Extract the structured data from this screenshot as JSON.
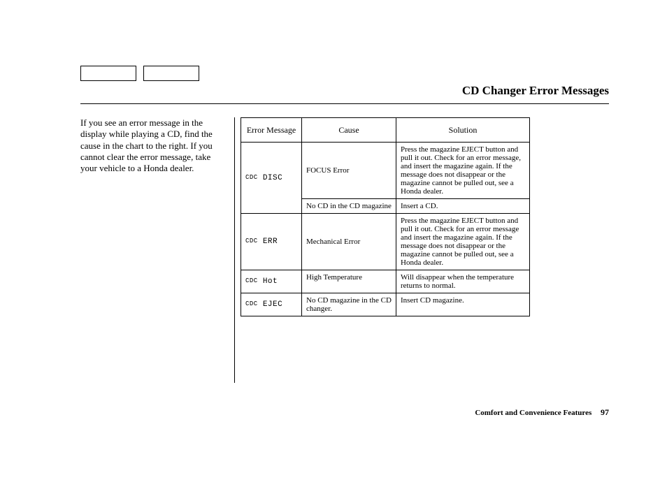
{
  "header": {
    "title": "CD Changer Error Messages"
  },
  "intro": "If you see an error message in the display while playing a CD, find the cause in the chart to the right. If you cannot clear the error message, take your vehicle to a Honda dealer.",
  "table": {
    "head": {
      "c1": "Error Message",
      "c2": "Cause",
      "c3": "Solution"
    },
    "rows": [
      {
        "display_prefix": "CDC",
        "display_main": "DISC",
        "cause": "FOCUS Error",
        "solution": "Press the magazine EJECT button and pull it out. Check for an error message, and insert the magazine again. If the message does not disappear or the magazine cannot be pulled out, see a Honda dealer."
      },
      {
        "display_prefix": "",
        "display_main": "",
        "cause": "No CD in the CD magazine",
        "solution": "Insert a CD."
      },
      {
        "display_prefix": "CDC",
        "display_main": "ERR",
        "cause": "Mechanical Error",
        "solution": "Press the magazine EJECT button and pull it out. Check for an error message and insert the magazine again. If the message does not disappear or the magazine cannot be pulled out, see a Honda dealer."
      },
      {
        "display_prefix": "CDC",
        "display_main": "Hot",
        "cause": "High Temperature",
        "solution": "Will disappear when the temperature returns to normal."
      },
      {
        "display_prefix": "CDC",
        "display_main": "EJEC",
        "cause": "No CD magazine in the CD changer.",
        "solution": "Insert CD magazine."
      }
    ]
  },
  "footer": {
    "section": "Comfort and Convenience Features",
    "page": "97"
  }
}
